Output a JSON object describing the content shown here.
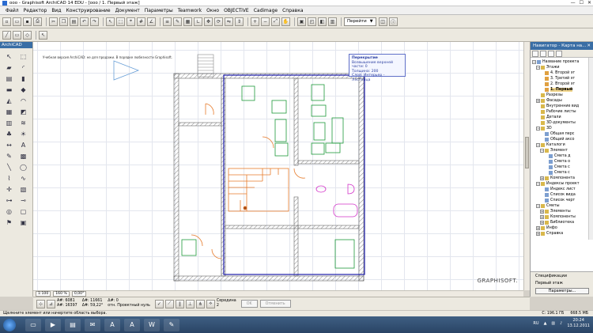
{
  "window": {
    "title": "ооо - Graphisoft ArchiCAD 14 EDU - [ооо / 1. Первый этаж]",
    "controls": [
      "—",
      "☐",
      "✕"
    ]
  },
  "menu": [
    "Файл",
    "Редактор",
    "Вид",
    "Конструирование",
    "Документ",
    "Параметры",
    "Teamwork",
    "Окно",
    "OBJECTiVE",
    "Cadimage",
    "Справка"
  ],
  "toolbar": {
    "goto_label": "Перейти"
  },
  "toolbox_title": "ArchiCAD",
  "canvas": {
    "notice": "Учебная версия ArchiCAD: не для продажи. В порядке любезности Graphisoft.",
    "watermark": "GRAPHISOFT.",
    "tooltip": {
      "title": "Перекрытие",
      "line1": "Возвышение верхней части: 0",
      "line2": "Толщина: 200",
      "line3": "Слой: Интерьер - Лестница"
    }
  },
  "navigator": {
    "title": "Навигатор - Карта на...",
    "tree": [
      {
        "label": "Название проекта",
        "level": 0,
        "kind": "proj",
        "exp": "−"
      },
      {
        "label": "Этажи",
        "level": 1,
        "kind": "folder",
        "exp": "−"
      },
      {
        "label": "4. Второй эт",
        "level": 2,
        "kind": "floor"
      },
      {
        "label": "3. Третий эт",
        "level": 2,
        "kind": "floor"
      },
      {
        "label": "2. Второй эт",
        "level": 2,
        "kind": "floor"
      },
      {
        "label": "1. Первый",
        "level": 2,
        "kind": "floor",
        "selected": true
      },
      {
        "label": "Разрезы",
        "level": 1,
        "kind": "folder"
      },
      {
        "label": "Фасады",
        "level": 1,
        "kind": "folder",
        "exp": "+"
      },
      {
        "label": "Внутренние вид",
        "level": 1,
        "kind": "folder"
      },
      {
        "label": "Рабочие листы",
        "level": 1,
        "kind": "folder"
      },
      {
        "label": "Детали",
        "level": 1,
        "kind": "folder"
      },
      {
        "label": "3D-документы",
        "level": 1,
        "kind": "folder"
      },
      {
        "label": "3D",
        "level": 1,
        "kind": "folder",
        "exp": "−"
      },
      {
        "label": "Общая перс",
        "level": 2,
        "kind": "item"
      },
      {
        "label": "Общий аксо",
        "level": 2,
        "kind": "item"
      },
      {
        "label": "Каталоги",
        "level": 1,
        "kind": "folder",
        "exp": "−"
      },
      {
        "label": "Элемент",
        "level": 2,
        "kind": "folder",
        "exp": "−"
      },
      {
        "label": "Смета д",
        "level": 3,
        "kind": "item"
      },
      {
        "label": "Смета о",
        "level": 3,
        "kind": "item"
      },
      {
        "label": "Смета с",
        "level": 3,
        "kind": "item"
      },
      {
        "label": "Смета с",
        "level": 3,
        "kind": "item"
      },
      {
        "label": "Компонента",
        "level": 2,
        "kind": "folder",
        "exp": "+"
      },
      {
        "label": "Индексы проект",
        "level": 1,
        "kind": "folder",
        "exp": "−"
      },
      {
        "label": "Индекс лист",
        "level": 2,
        "kind": "item"
      },
      {
        "label": "Список вида",
        "level": 2,
        "kind": "item"
      },
      {
        "label": "Список черт",
        "level": 2,
        "kind": "item"
      },
      {
        "label": "Сметы",
        "level": 1,
        "kind": "folder",
        "exp": "−"
      },
      {
        "label": "Элементы",
        "level": 2,
        "kind": "folder",
        "exp": "+"
      },
      {
        "label": "Компоненты",
        "level": 2,
        "kind": "folder",
        "exp": "+"
      },
      {
        "label": "Библиотека",
        "level": 2,
        "kind": "folder",
        "exp": "+"
      },
      {
        "label": "Инфо",
        "level": 1,
        "kind": "folder",
        "exp": "+"
      },
      {
        "label": "Справка",
        "level": 1,
        "kind": "folder",
        "exp": "+"
      }
    ],
    "spec_label": "Спецификации",
    "current_floor": "Первый этаж",
    "params_button": "Параметры..."
  },
  "hscroll": {
    "scale": "1:100",
    "zoom": "160 %",
    "angle": "0,00°"
  },
  "infobox": {
    "ax_label": "A#: 6081",
    "ay_label": "A#: 16397",
    "dr_label": "Δ#: 11661",
    "da_label": "Δ#: 59,22°",
    "z_label": "Δ#: 0",
    "ref_label": "отн. Проектный нуль",
    "snap_label": "Середина",
    "snap_value": "2",
    "ok": "OK",
    "cancel": "Отменить"
  },
  "status": {
    "hint": "Щелкните элемент или начертите область выбора.",
    "disk": "C: 196.1 ГБ",
    "mem": "668.5 МБ"
  },
  "taskbar": {
    "lang": "RU",
    "time": "20:24",
    "date": "13.12.2011"
  }
}
